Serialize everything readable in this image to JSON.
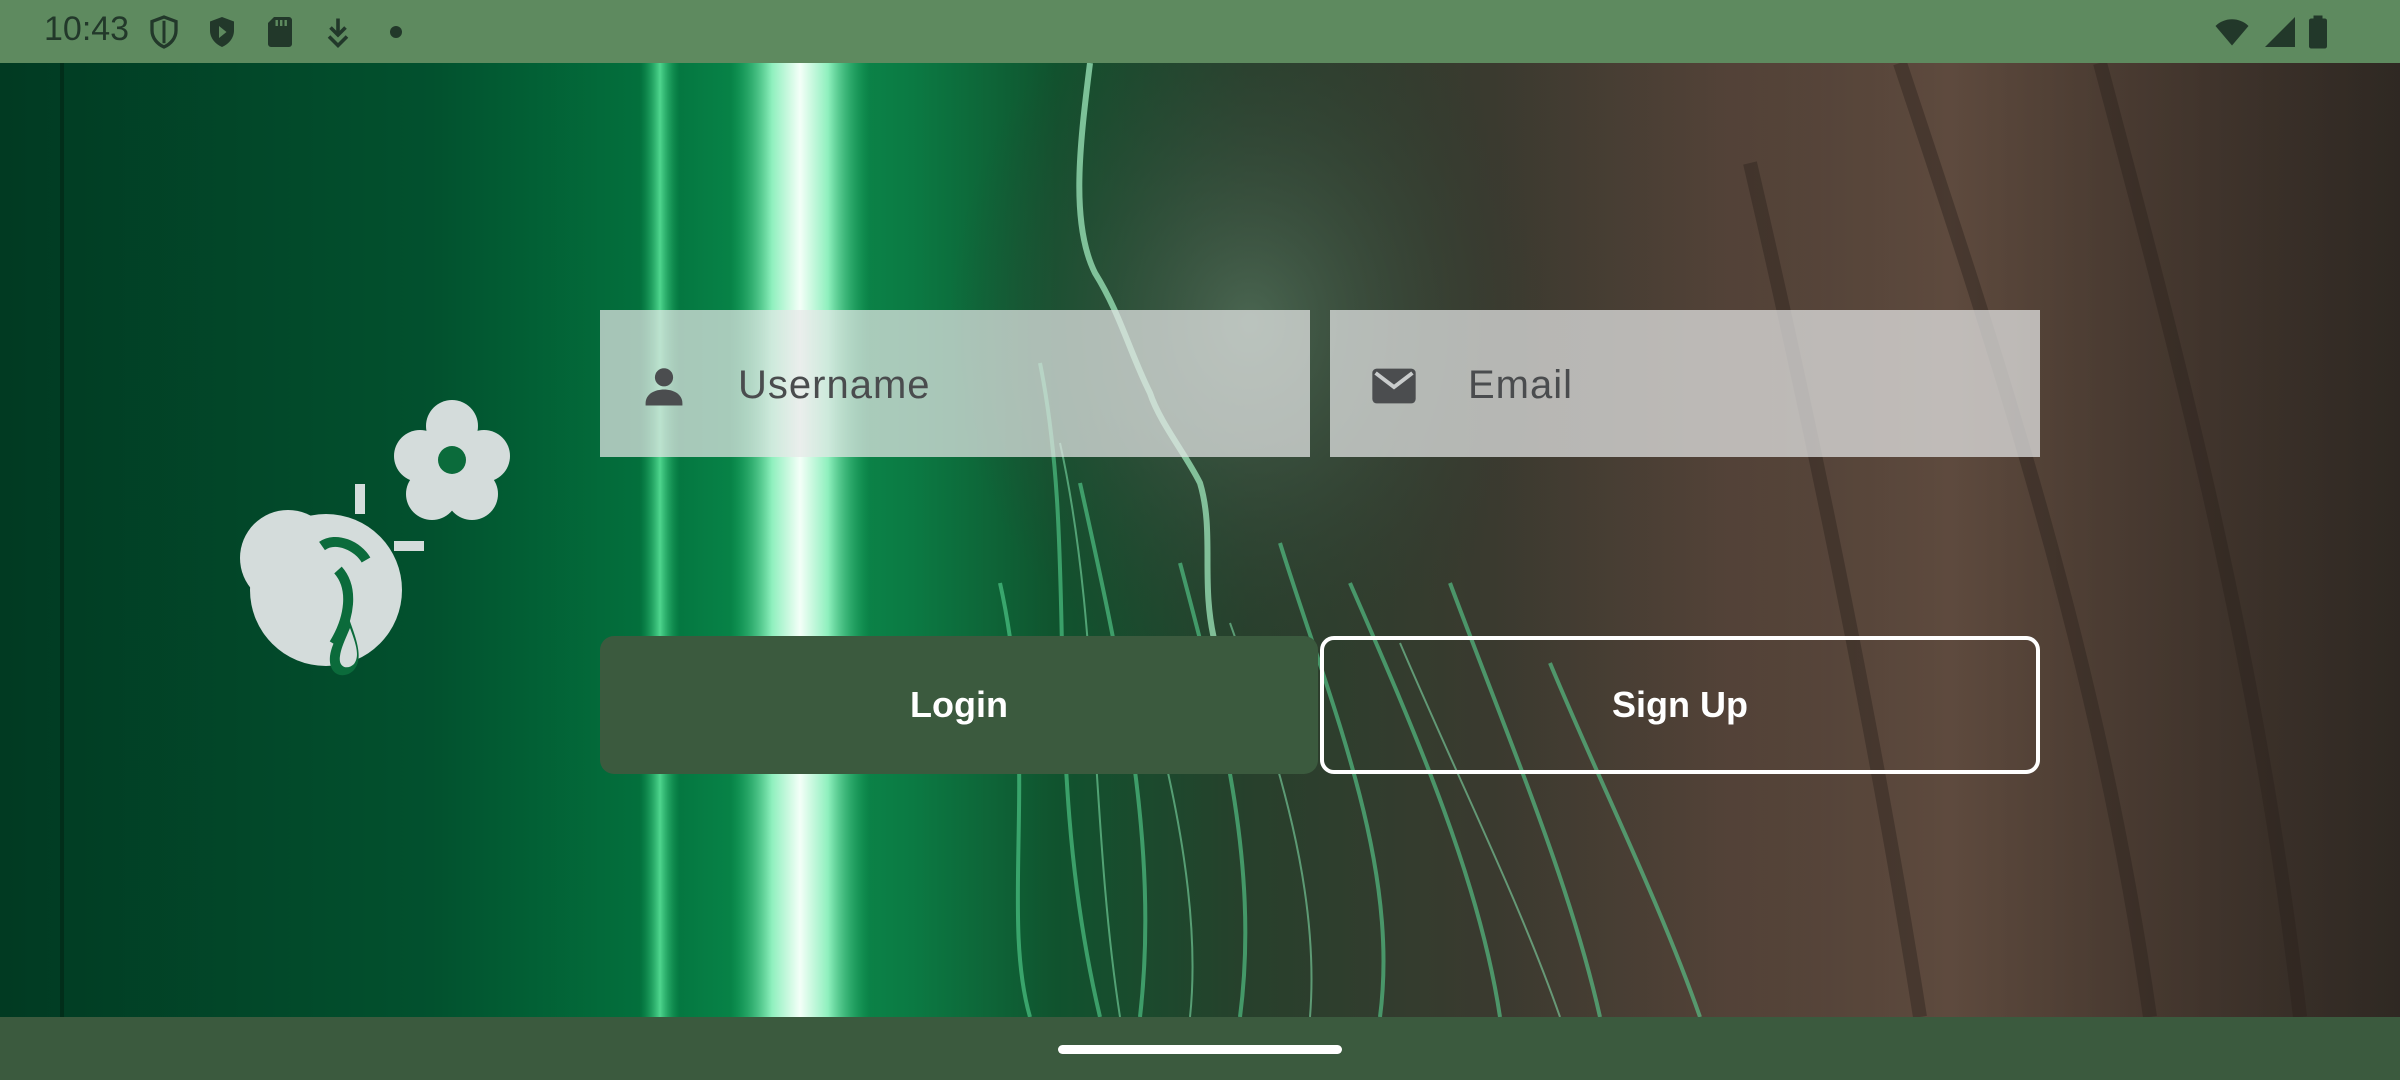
{
  "status_bar": {
    "time": "10:43",
    "left_icons": [
      "shield-outline-icon",
      "play-protect-icon",
      "sd-card-icon",
      "download-icon",
      "dot-icon"
    ],
    "right_icons": [
      "wifi-icon",
      "cellular-signal-icon",
      "battery-icon"
    ]
  },
  "logo": {
    "icon": "bee-flower-logo-icon"
  },
  "form": {
    "username": {
      "placeholder": "Username",
      "value": "",
      "icon": "person-icon"
    },
    "email": {
      "placeholder": "Email",
      "value": "",
      "icon": "mail-icon"
    }
  },
  "buttons": {
    "login_label": "Login",
    "signup_label": "Sign Up"
  },
  "colors": {
    "status_bar": "#5e8a5f",
    "primary": "#3b5a3e",
    "field_bg": "#e6e8e8",
    "logo": "#d4dcdb"
  }
}
